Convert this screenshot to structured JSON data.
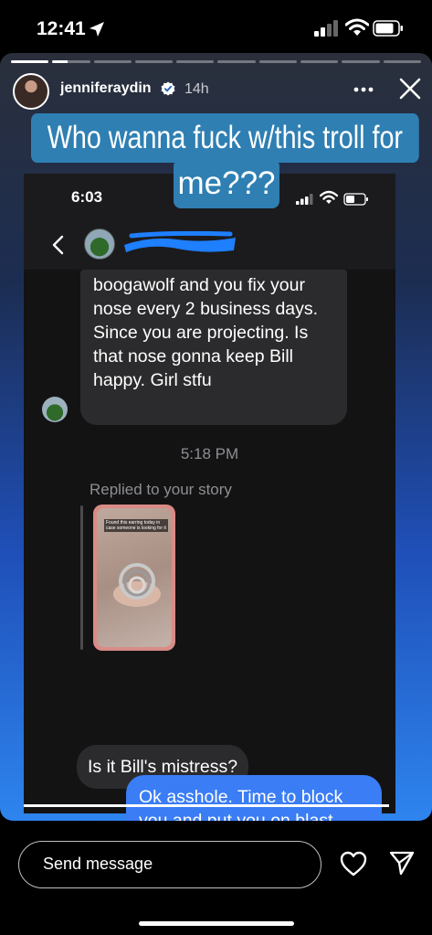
{
  "status_bar": {
    "time": "12:41",
    "icons": [
      "location-arrow-icon",
      "cellular-signal-icon",
      "wifi-icon",
      "battery-icon"
    ]
  },
  "story": {
    "username": "jenniferaydin",
    "verified": true,
    "posted_ago": "14h",
    "progress": {
      "segments": 10,
      "completed": 1,
      "current_fraction": 0.4
    },
    "caption_line1": "Who wanna fuck w/this troll for",
    "caption_line2": "me???",
    "caption_bg": "#2f7fb3",
    "screenshot": {
      "time": "6:03",
      "contact_name_redacted": true,
      "redaction_color": "#1e7fff",
      "messages": {
        "incoming_1": "boogawolf and you fix your nose every 2 business days. Since you are projecting. Is that nose gonna keep Bill happy. Girl stfu",
        "timestamp": "5:18 PM",
        "reply_label": "Replied to your story",
        "story_caption": "Found this earring today in case someone is looking for it",
        "incoming_2": "Is it Bill's mistress?",
        "outgoing_1": "Ok asshole. Time to block you and put you on blast."
      },
      "outgoing_color": "#3a7df5"
    }
  },
  "bottom_bar": {
    "input_placeholder": "Send message",
    "icons": [
      "heart-icon",
      "send-icon"
    ]
  }
}
